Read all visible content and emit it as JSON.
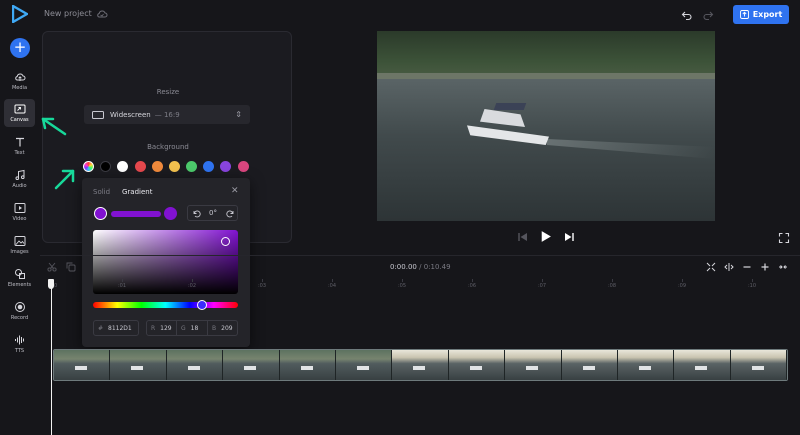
{
  "header": {
    "project_title": "New project",
    "export_label": "Export",
    "accent": "#2f73f0"
  },
  "sidebar": {
    "items": [
      {
        "label": "Media",
        "icon": "upload-cloud-icon"
      },
      {
        "label": "Canvas",
        "icon": "canvas-resize-icon",
        "active": true
      },
      {
        "label": "Text",
        "icon": "text-icon"
      },
      {
        "label": "Audio",
        "icon": "music-note-icon"
      },
      {
        "label": "Video",
        "icon": "video-play-icon"
      },
      {
        "label": "Images",
        "icon": "image-icon"
      },
      {
        "label": "Elements",
        "icon": "shapes-icon"
      },
      {
        "label": "Record",
        "icon": "record-icon"
      },
      {
        "label": "TTS",
        "icon": "waveform-icon"
      }
    ]
  },
  "canvas_panel": {
    "resize_heading": "Resize",
    "resize_value": "Widescreen",
    "resize_ratio": "— 16:9",
    "background_heading": "Background",
    "swatches": [
      "#000000",
      "#ffffff",
      "#e5484d",
      "#f08a3c",
      "#f2c14e",
      "#4cc96b",
      "#2f73f0",
      "#8844dd",
      "#d9467e"
    ]
  },
  "color_picker": {
    "tab_solid": "Solid",
    "tab_gradient": "Gradient",
    "active_tab": "Gradient",
    "angle": "0°",
    "hex_label": "#",
    "hex_value": "8112D1",
    "r_label": "R",
    "r_value": "129",
    "g_label": "G",
    "g_value": "18",
    "b_label": "B",
    "b_value": "209",
    "color": "#8112d1"
  },
  "timeline": {
    "current_time": "0:00.00",
    "separator": "/",
    "total_time": "0:10.49",
    "ticks": [
      "0",
      ":01",
      ":02",
      ":03",
      ":04",
      ":05",
      ":06",
      ":07",
      ":08",
      ":09",
      ":10"
    ]
  }
}
